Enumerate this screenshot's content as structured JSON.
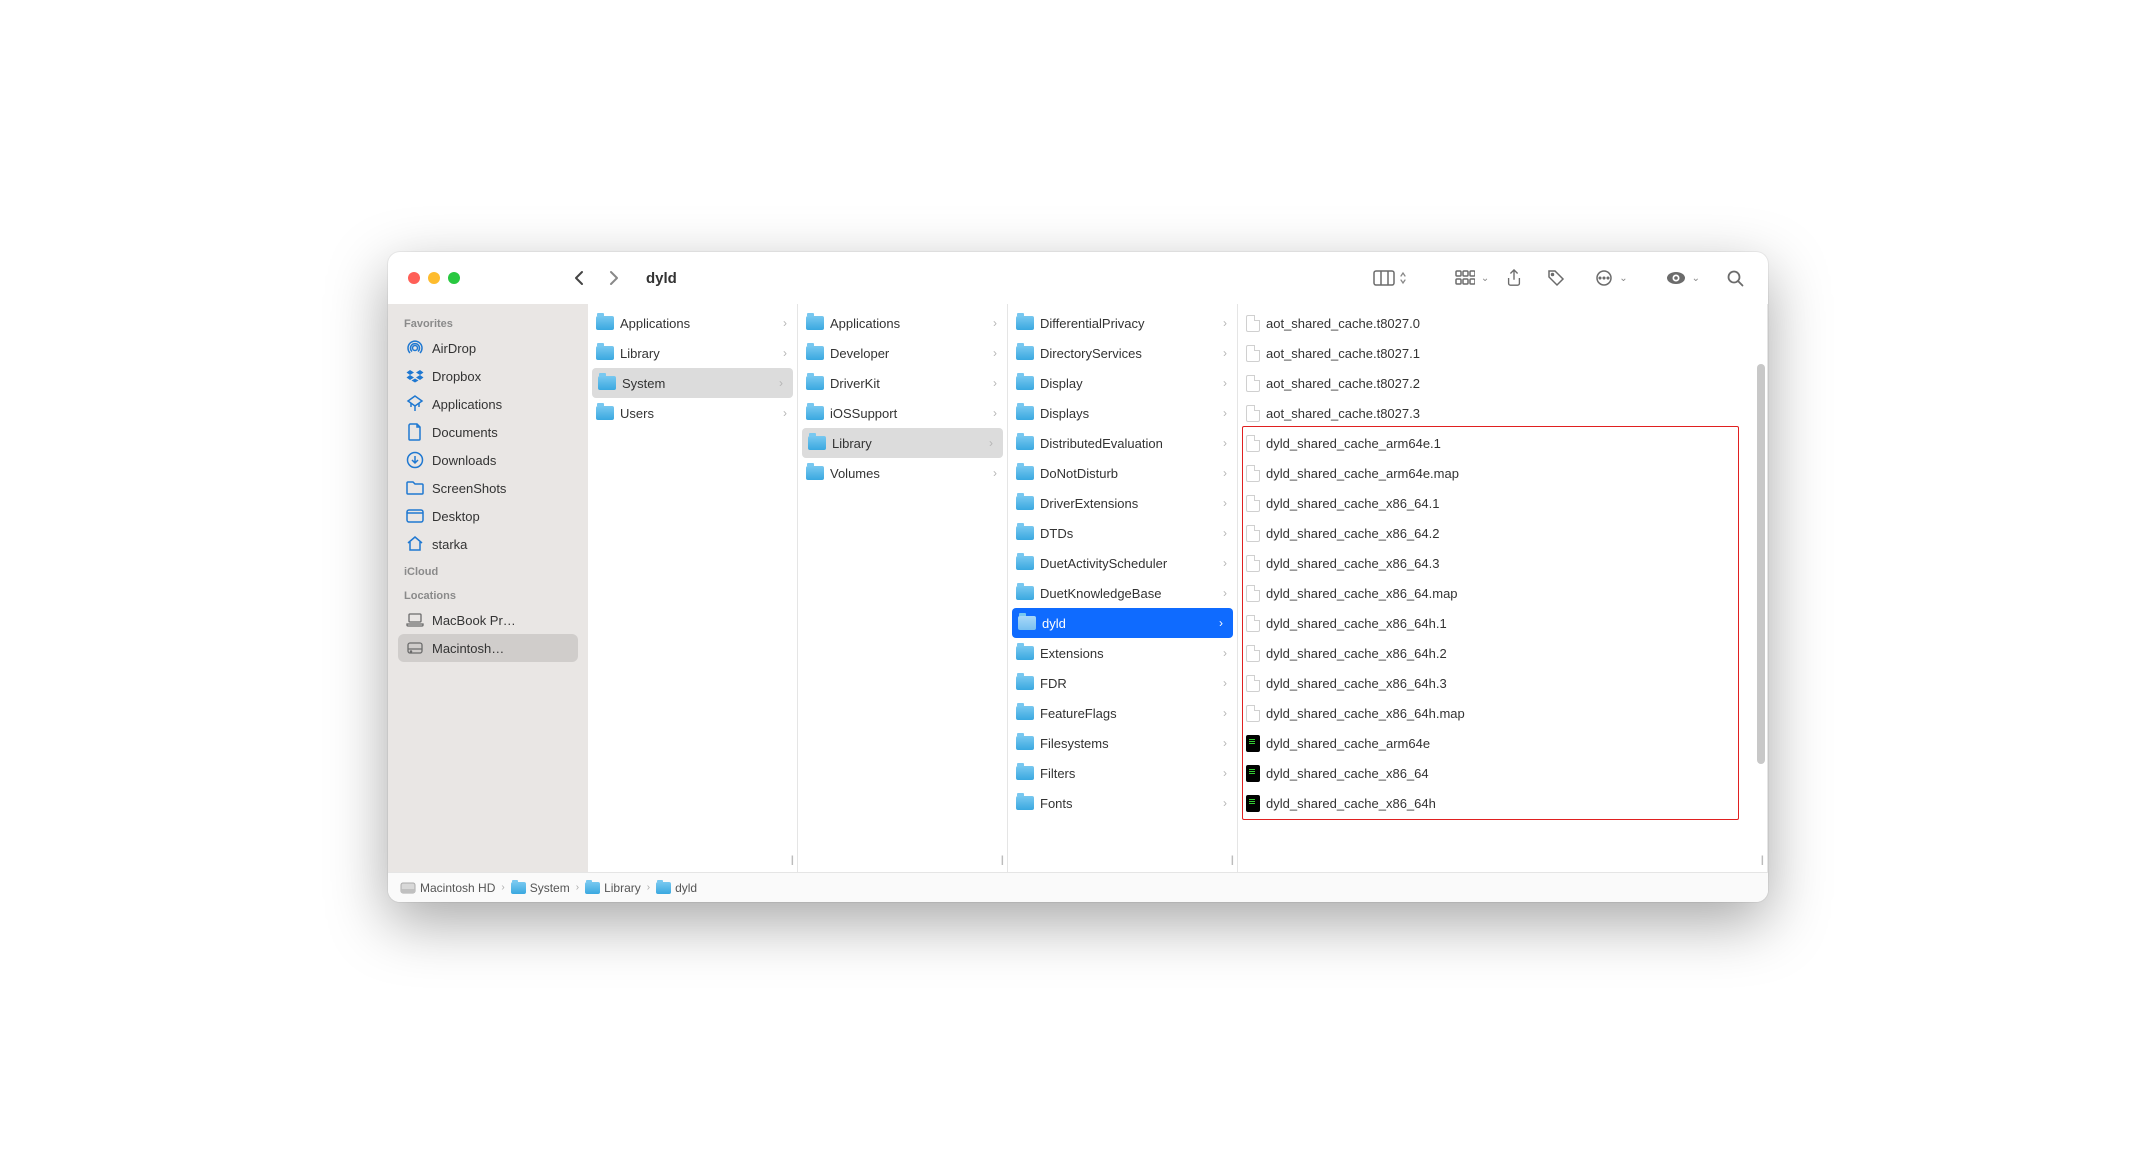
{
  "window_title": "dyld",
  "sidebar": {
    "sections": [
      {
        "label": "Favorites",
        "items": [
          {
            "icon": "airdrop",
            "label": "AirDrop"
          },
          {
            "icon": "dropbox",
            "label": "Dropbox"
          },
          {
            "icon": "apps",
            "label": "Applications"
          },
          {
            "icon": "doc",
            "label": "Documents"
          },
          {
            "icon": "download",
            "label": "Downloads"
          },
          {
            "icon": "folder",
            "label": "ScreenShots"
          },
          {
            "icon": "desktop",
            "label": "Desktop"
          },
          {
            "icon": "home",
            "label": "starka"
          }
        ]
      },
      {
        "label": "iCloud",
        "items": []
      },
      {
        "label": "Locations",
        "items": [
          {
            "icon": "laptop",
            "label": "MacBook Pr…"
          },
          {
            "icon": "disk",
            "label": "Macintosh…",
            "selected": true
          }
        ]
      }
    ]
  },
  "columns": [
    {
      "items": [
        {
          "type": "folder",
          "label": "Applications"
        },
        {
          "type": "folder",
          "label": "Library"
        },
        {
          "type": "folder",
          "label": "System",
          "selected": "grey"
        },
        {
          "type": "folder",
          "label": "Users"
        }
      ]
    },
    {
      "items": [
        {
          "type": "folder",
          "label": "Applications"
        },
        {
          "type": "folder",
          "label": "Developer"
        },
        {
          "type": "folder",
          "label": "DriverKit"
        },
        {
          "type": "folder",
          "label": "iOSSupport"
        },
        {
          "type": "folder",
          "label": "Library",
          "selected": "grey"
        },
        {
          "type": "folder",
          "label": "Volumes"
        }
      ]
    },
    {
      "items": [
        {
          "type": "folder",
          "label": "DifferentialPrivacy"
        },
        {
          "type": "folder",
          "label": "DirectoryServices"
        },
        {
          "type": "folder",
          "label": "Display"
        },
        {
          "type": "folder",
          "label": "Displays"
        },
        {
          "type": "folder",
          "label": "DistributedEvaluation"
        },
        {
          "type": "folder",
          "label": "DoNotDisturb"
        },
        {
          "type": "folder",
          "label": "DriverExtensions"
        },
        {
          "type": "folder",
          "label": "DTDs"
        },
        {
          "type": "folder",
          "label": "DuetActivityScheduler"
        },
        {
          "type": "folder",
          "label": "DuetKnowledgeBase"
        },
        {
          "type": "folder",
          "label": "dyld",
          "selected": "blue"
        },
        {
          "type": "folder",
          "label": "Extensions"
        },
        {
          "type": "folder",
          "label": "FDR"
        },
        {
          "type": "folder",
          "label": "FeatureFlags"
        },
        {
          "type": "folder",
          "label": "Filesystems"
        },
        {
          "type": "folder",
          "label": "Filters"
        },
        {
          "type": "folder",
          "label": "Fonts"
        }
      ]
    },
    {
      "items": [
        {
          "type": "file",
          "label": "aot_shared_cache.t8027.0"
        },
        {
          "type": "file",
          "label": "aot_shared_cache.t8027.1"
        },
        {
          "type": "file",
          "label": "aot_shared_cache.t8027.2"
        },
        {
          "type": "file",
          "label": "aot_shared_cache.t8027.3"
        },
        {
          "type": "file",
          "label": "dyld_shared_cache_arm64e.1",
          "boxed": true
        },
        {
          "type": "file",
          "label": "dyld_shared_cache_arm64e.map",
          "boxed": true
        },
        {
          "type": "file",
          "label": "dyld_shared_cache_x86_64.1",
          "boxed": true
        },
        {
          "type": "file",
          "label": "dyld_shared_cache_x86_64.2",
          "boxed": true
        },
        {
          "type": "file",
          "label": "dyld_shared_cache_x86_64.3",
          "boxed": true
        },
        {
          "type": "file",
          "label": "dyld_shared_cache_x86_64.map",
          "boxed": true
        },
        {
          "type": "file",
          "label": "dyld_shared_cache_x86_64h.1",
          "boxed": true
        },
        {
          "type": "file",
          "label": "dyld_shared_cache_x86_64h.2",
          "boxed": true
        },
        {
          "type": "file",
          "label": "dyld_shared_cache_x86_64h.3",
          "boxed": true
        },
        {
          "type": "file",
          "label": "dyld_shared_cache_x86_64h.map",
          "boxed": true
        },
        {
          "type": "exec",
          "label": "dyld_shared_cache_arm64e",
          "boxed": true
        },
        {
          "type": "exec",
          "label": "dyld_shared_cache_x86_64",
          "boxed": true
        },
        {
          "type": "exec",
          "label": "dyld_shared_cache_x86_64h",
          "boxed": true
        }
      ]
    }
  ],
  "pathbar": [
    "Macintosh HD",
    "System",
    "Library",
    "dyld"
  ]
}
